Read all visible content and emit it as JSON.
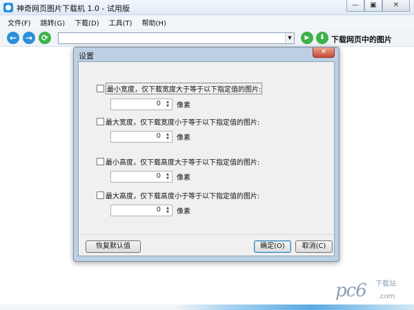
{
  "window": {
    "title": "神奇网页图片下载机 1.0 - 试用版",
    "minimize_glyph": "—",
    "maximize_glyph": "▣",
    "close_glyph": "✕"
  },
  "menu": [
    "文件(F)",
    "跳转(G)",
    "下载(D)",
    "工具(T)",
    "帮助(H)"
  ],
  "toolbar": {
    "back_glyph": "←",
    "forward_glyph": "→",
    "refresh_glyph": "⟳",
    "url_value": "",
    "dropdown_glyph": "▼",
    "go_glyph": "▶",
    "download_glyph": "⬇",
    "download_label": "下载网页中的图片"
  },
  "dialog": {
    "title": "设置",
    "close_glyph": "✕",
    "options": [
      {
        "label": "最小宽度，仅下载宽度大于等于以下指定值的图片:",
        "value": "0",
        "unit": "像素",
        "checked": false
      },
      {
        "label": "最大宽度，仅下载宽度小于等于以下指定值的图片:",
        "value": "0",
        "unit": "像素",
        "checked": false
      },
      {
        "label": "最小高度，仅下载高度大于等于以下指定值的图片:",
        "value": "0",
        "unit": "像素",
        "checked": false
      },
      {
        "label": "最大高度，仅下载高度小于等于以下指定值的图片:",
        "value": "0",
        "unit": "像素",
        "checked": false
      }
    ],
    "restore_label": "恢复默认值",
    "ok_label": "确定(O)",
    "cancel_label": "取消(C)"
  },
  "watermark": {
    "main": "pc6",
    "sub": "下载站",
    "domain": ".com"
  },
  "colors": {
    "accent_blue": "#2b90d9",
    "accent_green": "#3bb24a",
    "dialog_frame": "#bccfe3"
  }
}
